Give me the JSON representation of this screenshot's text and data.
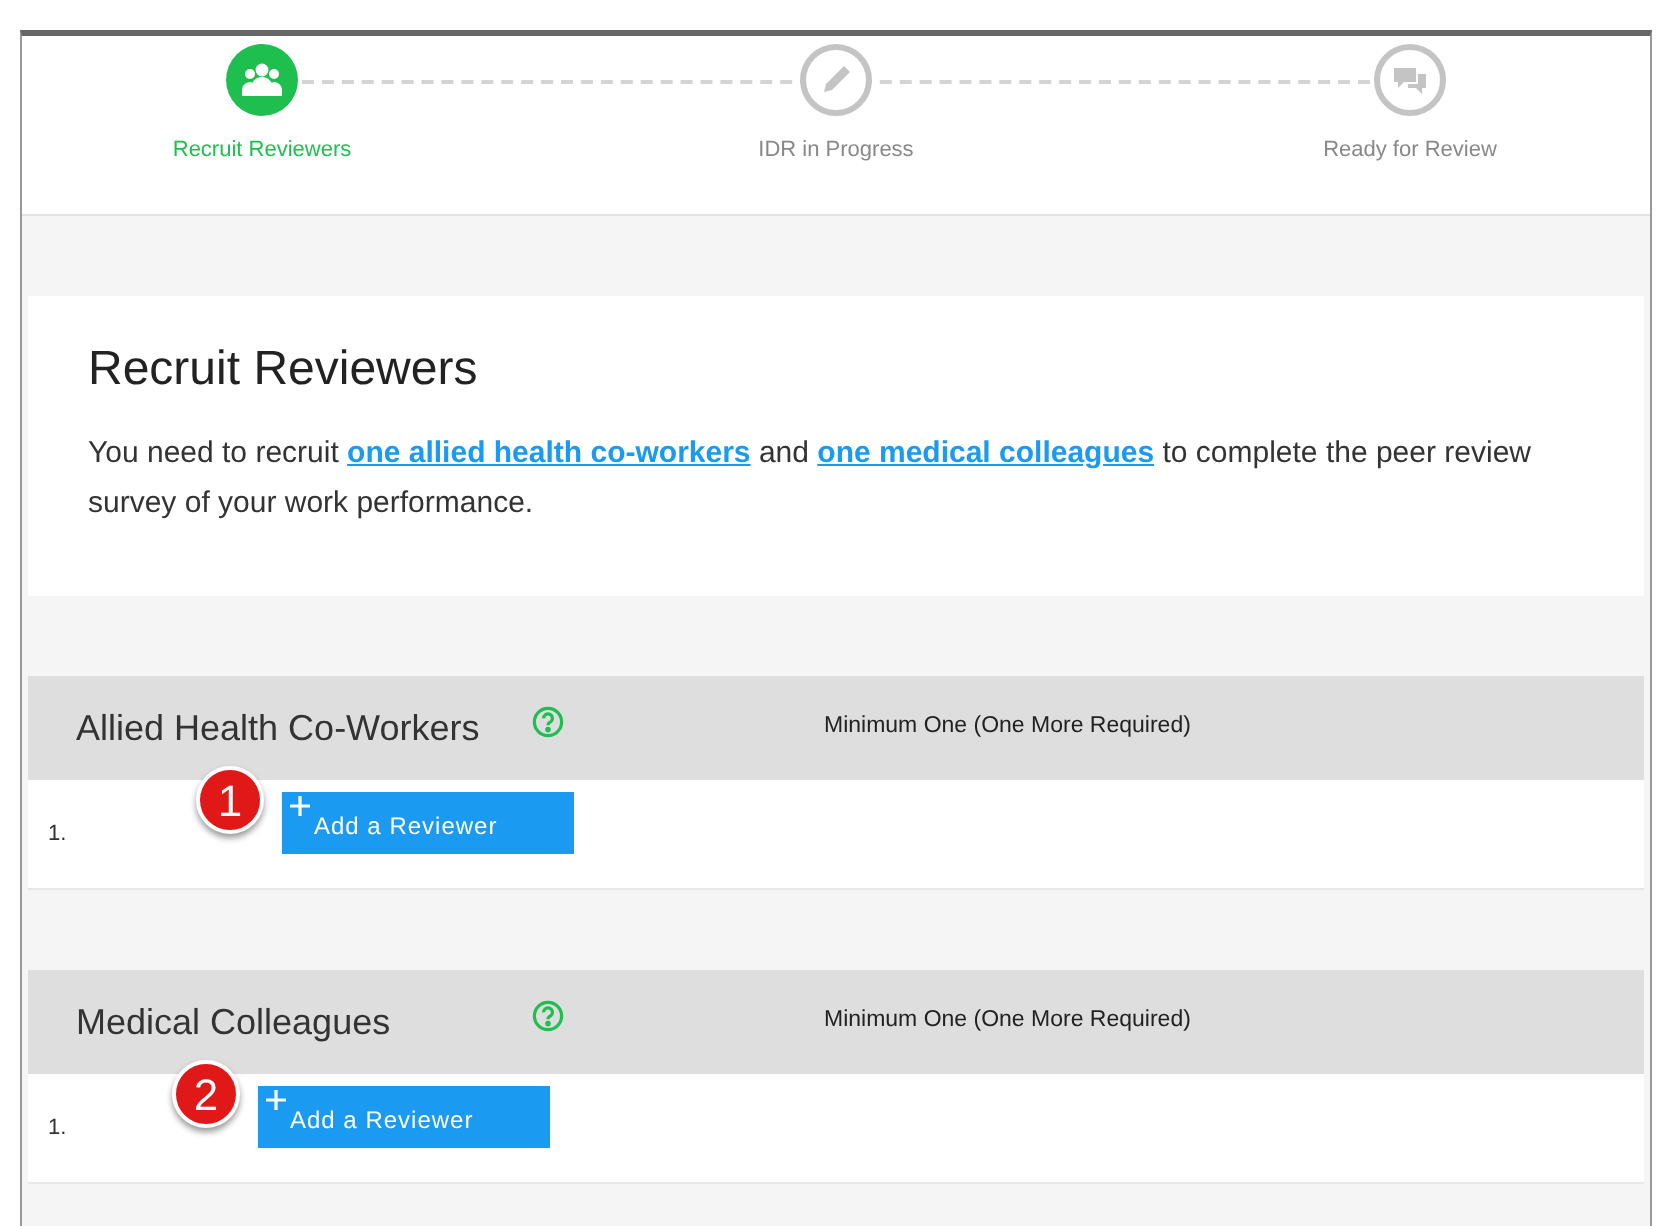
{
  "steps": [
    {
      "label": "Recruit Reviewers",
      "kind": "people",
      "selected": true
    },
    {
      "label": "IDR in Progress",
      "kind": "pencil",
      "selected": false
    },
    {
      "label": "Ready for Review",
      "kind": "chat",
      "selected": false
    }
  ],
  "intro": {
    "title": "Recruit Reviewers",
    "text_before": "You need to recruit",
    "link_1": "one allied health co-workers",
    "text_middle": "and",
    "link_2": "one medical colleagues",
    "text_after": "to complete the peer review survey of your work performance."
  },
  "sections": [
    {
      "title": "Allied Health Co-Workers",
      "requirement": "Minimum One (One More Required)",
      "rows": [
        {
          "number": "1.",
          "button": "Add a Reviewer",
          "callout": "1"
        }
      ]
    },
    {
      "title": "Medical Colleagues",
      "requirement": "Minimum One (One More Required)",
      "rows": [
        {
          "number": "1.",
          "button": "Add a Reviewer",
          "callout": "2"
        }
      ]
    }
  ]
}
